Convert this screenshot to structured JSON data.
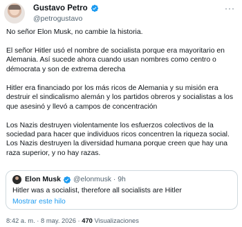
{
  "author": {
    "name": "Gustavo Petro",
    "handle": "@petrogustavo",
    "verified_icon": "verified-badge-icon",
    "more_icon": "more-options-icon"
  },
  "tweet": {
    "paragraphs": [
      "No señor Elon Musk, no cambie la historia.",
      "El señor Hitler usó el nombre de socialista porque era mayoritario en Alemania. Así sucede ahora cuando usan nombres como centro o démocrata y son de extrema derecha",
      "Hitler era financiado por los más ricos de Alemania y su misión era destruir el sindicalismo alemán y los partidos obreros y socialistas a los que asesinó y llevó a campos de concentración",
      "Los Nazis destruyen violentamente los esfuerzos colectivos de la sociedad para hacer que individuos ricos concentren la riqueza social. Los Nazis destruyen la diversidad humana porque creen que hay una raza superior, y no hay razas."
    ]
  },
  "quoted": {
    "name": "Elon Musk",
    "handle_time": "@elonmusk · 9h",
    "text": "Hitler was a socialist, therefore all socialists are Hitler",
    "show_thread": "Mostrar este hilo"
  },
  "meta": {
    "time_date": "8:42 a. m. · 8 may. 2026 · ",
    "views_count": "470",
    "views_label": " Visualizaciones"
  },
  "colors": {
    "verified": "#1d9bf0",
    "link": "#1d9bf0",
    "secondary_text": "#536471",
    "border": "#cfd9de"
  }
}
